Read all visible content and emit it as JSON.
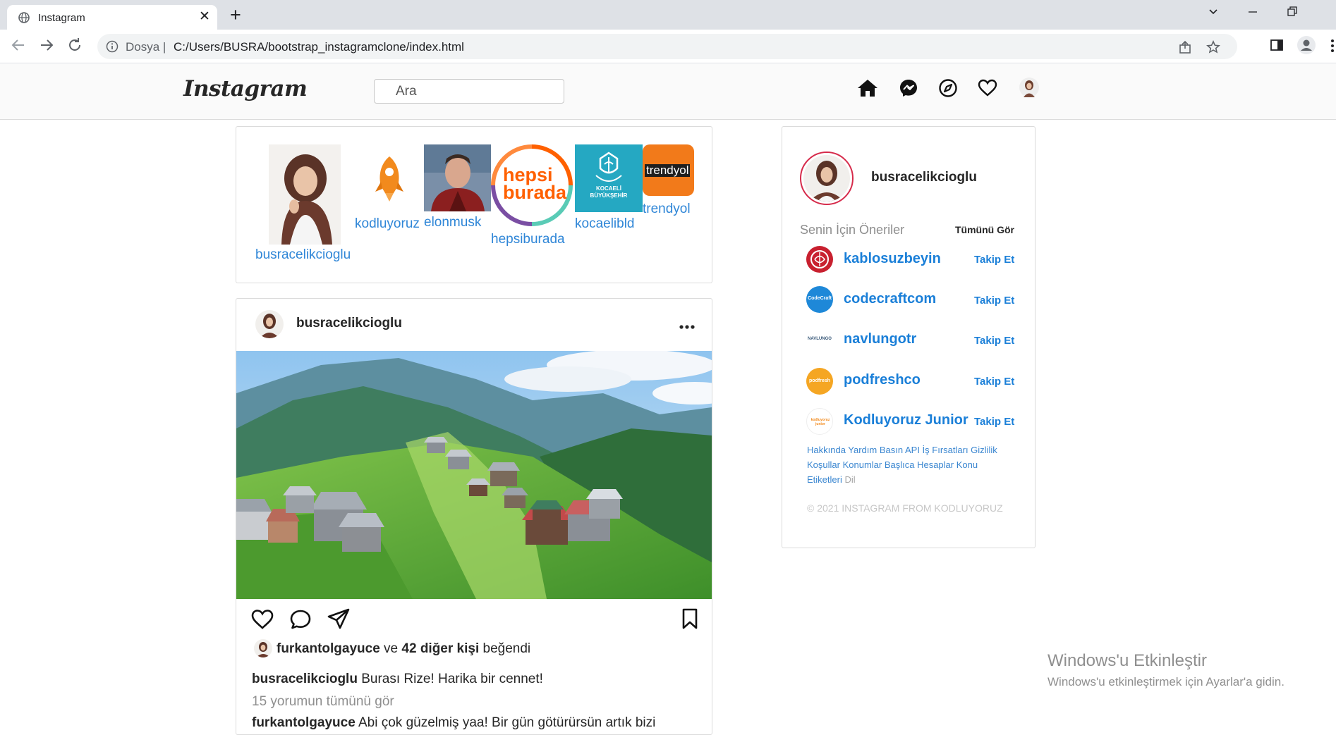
{
  "browser": {
    "tab_title": "Instagram",
    "address_scheme": "Dosya",
    "address_separator": "|",
    "address_url": "C:/Users/BUSRA/bootstrap_instagramclone/index.html"
  },
  "header": {
    "logo": "Instagram",
    "search_placeholder": "Ara",
    "nav_icons": [
      "home-icon",
      "messenger-icon",
      "explore-icon",
      "heart-icon",
      "profile-avatar"
    ]
  },
  "stories": [
    {
      "username": "busracelikcioglu"
    },
    {
      "username": "kodluyoruz"
    },
    {
      "username": "elonmusk"
    },
    {
      "username": "hepsiburada",
      "logo_text_line1": "hepsi",
      "logo_text_line2": "burada"
    },
    {
      "username": "kocaelibld",
      "logo_text_line1": "KOCAELİ",
      "logo_text_line2": "BÜYÜKŞEHİR"
    },
    {
      "username": "trendyol",
      "logo_text": "trendyol"
    }
  ],
  "post": {
    "username": "busracelikcioglu",
    "liked_by_user": "furkantolgayuce",
    "liked_by_and": "ve",
    "liked_by_others": "42 diğer kişi",
    "liked_by_suffix": "beğendi",
    "caption_user": "busracelikcioglu",
    "caption_text": "Burası Rize! Harika bir cennet!",
    "view_comments": "15 yorumun tümünü gör",
    "comment_user": "furkantolgayuce",
    "comment_text": "Abi çok güzelmiş yaa! Bir gün götürürsün artık bizi"
  },
  "sidebar": {
    "profile_username": "busracelikcioglu",
    "suggestions_title": "Senin İçin Öneriler",
    "see_all": "Tümünü Gör",
    "suggestions": [
      {
        "username": "kablosuzbeyin",
        "action": "Takip Et"
      },
      {
        "username": "codecraftcom",
        "action": "Takip Et",
        "logo_text": "CodeCraft"
      },
      {
        "username": "navlungotr",
        "action": "Takip Et",
        "logo_text": "NAVLUNGO"
      },
      {
        "username": "podfreshco",
        "action": "Takip Et",
        "logo_text": "podfresh"
      },
      {
        "username": "Kodluyoruz Junior",
        "action": "Takip Et",
        "logo_text": "kodluyoruz junior"
      }
    ],
    "footer_links": "Hakkında Yardım Basın API İş Fırsatları Gizlilik Koşullar Konumlar Başlıca Hesaplar Konu Etiketleri",
    "footer_lang": "Dil",
    "copyright": "© 2021 INSTAGRAM FROM KODLUYORUZ"
  },
  "windows_watermark": {
    "title": "Windows'u Etkinleştir",
    "subtitle": "Windows'u etkinleştirmek için Ayarlar'a gidin."
  },
  "colors": {
    "link_blue": "#1a7fd8",
    "story_blue": "#2f86d7",
    "hepsiburada_orange": "#ff6000",
    "kocaeli_teal": "#25a8c2",
    "trendyol_orange": "#f27a1a"
  }
}
